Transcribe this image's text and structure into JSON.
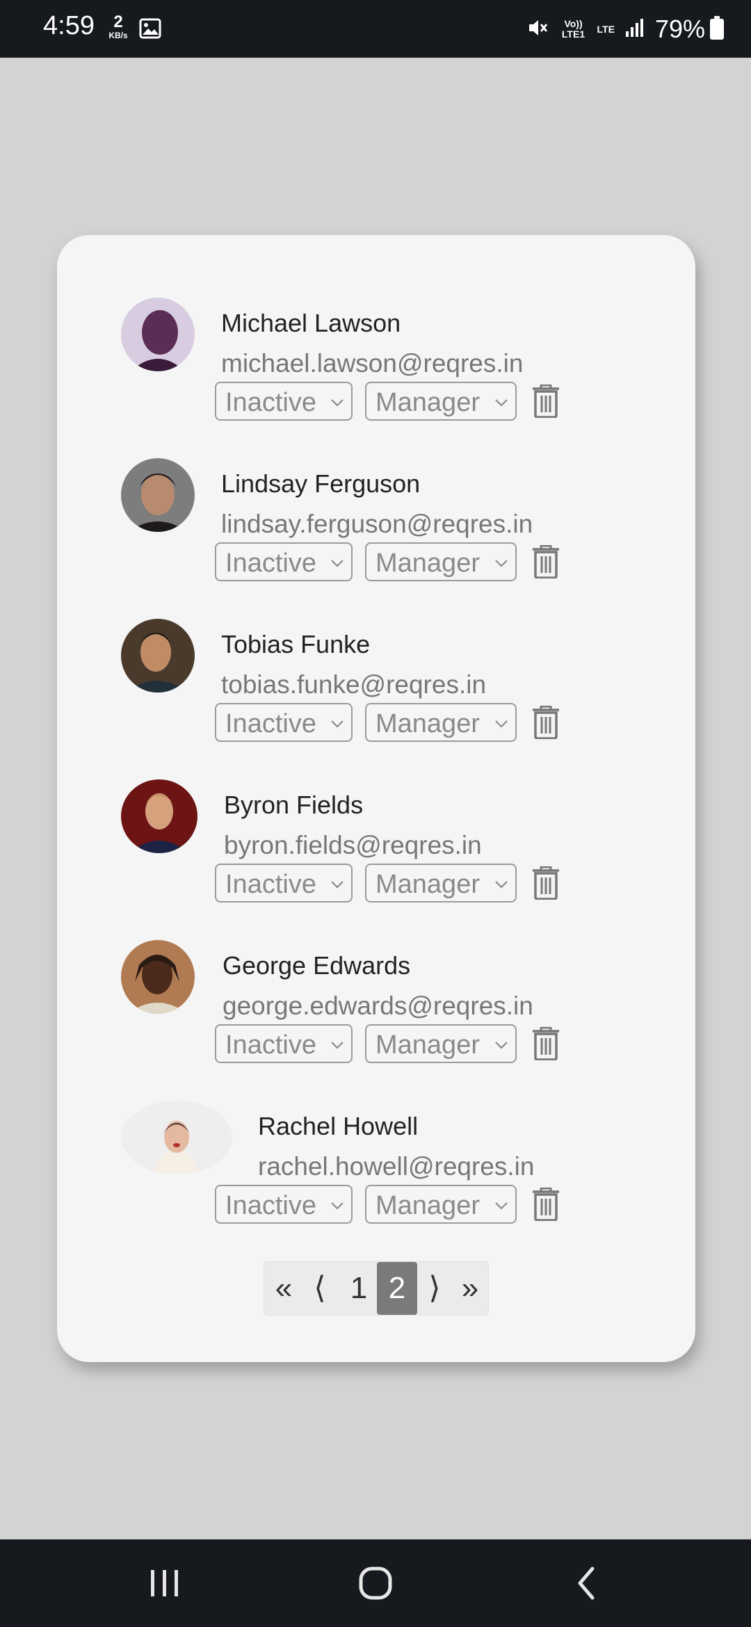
{
  "status_bar": {
    "time": "4:59",
    "speed_value": "2",
    "speed_unit": "KB/s",
    "volte_label": "Vo)) LTE1",
    "lte_label": "LTE",
    "battery": "79%"
  },
  "users": [
    {
      "name": "Michael Lawson",
      "email": "michael.lawson@reqres.in",
      "status": "Inactive",
      "role": "Manager",
      "avatar_colors": [
        "#d8cde0",
        "#5a2d55",
        "#3a1b3a"
      ]
    },
    {
      "name": "Lindsay Ferguson",
      "email": "lindsay.ferguson@reqres.in",
      "status": "Inactive",
      "role": "Manager",
      "avatar_colors": [
        "#7d7d7d",
        "#b98b6e",
        "#1e1a19"
      ]
    },
    {
      "name": "Tobias Funke",
      "email": "tobias.funke@reqres.in",
      "status": "Inactive",
      "role": "Manager",
      "avatar_colors": [
        "#4a3a2c",
        "#c08c66",
        "#22303a"
      ]
    },
    {
      "name": "Byron Fields",
      "email": "byron.fields@reqres.in",
      "status": "Inactive",
      "role": "Manager",
      "avatar_colors": [
        "#6d1414",
        "#d6a27e",
        "#1d2344"
      ]
    },
    {
      "name": "George Edwards",
      "email": "george.edwards@reqres.in",
      "status": "Inactive",
      "role": "Manager",
      "avatar_colors": [
        "#b07a52",
        "#4b2a1c",
        "#2a1a14"
      ]
    },
    {
      "name": "Rachel Howell",
      "email": "rachel.howell@reqres.in",
      "status": "Inactive",
      "role": "Manager",
      "avatar_colors": [
        "#eeeeee",
        "#e5b9a0",
        "#3a2a24"
      ]
    }
  ],
  "pagination": {
    "first": "«",
    "prev": "⟨",
    "pages": [
      "1",
      "2"
    ],
    "current_page": "2",
    "next": "⟩",
    "last": "»"
  },
  "icons": {
    "gallery": "image-icon",
    "mute": "mute-icon",
    "signal": "signal-icon",
    "battery": "battery-icon",
    "trash": "trash-icon",
    "recent": "recent-apps-icon",
    "home": "home-icon",
    "back": "back-icon"
  }
}
